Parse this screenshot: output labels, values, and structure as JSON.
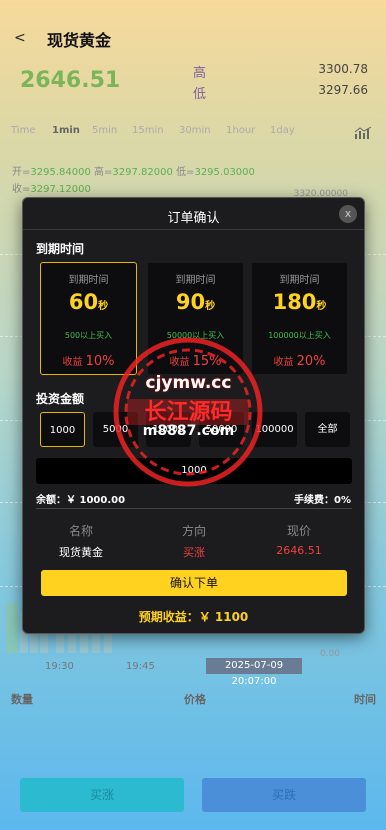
{
  "header": {
    "back": "<",
    "title": "现货黄金"
  },
  "quote": {
    "price": "2646.51",
    "high_label": "高",
    "low_label": "低",
    "high": "3300.78",
    "low": "3297.66"
  },
  "tabs": [
    {
      "label": "Time",
      "active": false
    },
    {
      "label": "1min",
      "active": true
    },
    {
      "label": "5min",
      "active": false
    },
    {
      "label": "15min",
      "active": false
    },
    {
      "label": "30min",
      "active": false
    },
    {
      "label": "1hour",
      "active": false
    },
    {
      "label": "1day",
      "active": false
    }
  ],
  "ohlc": {
    "open_label": "开=",
    "open": "3295.84000",
    "high_label": "高=",
    "high": "3297.82000",
    "low_label": "低=",
    "low": "3295.03000",
    "close_label": "收=",
    "close": "3297.12000"
  },
  "chart_axis": {
    "top_value": "3320.00000",
    "bottom_value": "0.00",
    "times": [
      "19:30",
      "19:45"
    ],
    "current_time": "2025-07-09 20:07:00"
  },
  "list_headers": {
    "qty": "数量",
    "price": "价格",
    "time": "时间"
  },
  "bottom_buttons": {
    "buy": "买涨",
    "sell": "买跌"
  },
  "modal": {
    "title": "订单确认",
    "close": "x",
    "expire_label": "到期时间",
    "expire_options": [
      {
        "label": "到期时间",
        "value": "60",
        "unit": "秒",
        "min": "500以上买入",
        "profit_label": "收益",
        "profit": "10%",
        "selected": true
      },
      {
        "label": "到期时间",
        "value": "90",
        "unit": "秒",
        "min": "50000以上买入",
        "profit_label": "收益",
        "profit": "15%",
        "selected": false
      },
      {
        "label": "到期时间",
        "value": "180",
        "unit": "秒",
        "min": "100000以上买入",
        "profit_label": "收益",
        "profit": "20%",
        "selected": false
      }
    ],
    "amount_label": "投资金额",
    "amount_options": [
      "1000",
      "5000",
      "10000",
      "50000",
      "100000",
      "全部"
    ],
    "amount_value": "1000",
    "balance": "余额：￥ 1000.00",
    "fee": "手续费：0%",
    "info": [
      {
        "head": "名称",
        "value": "现货黄金",
        "color": "#ffffff"
      },
      {
        "head": "方向",
        "value": "买涨",
        "color": "#f04040"
      },
      {
        "head": "现价",
        "value": "2646.51",
        "color": "#f04040"
      }
    ],
    "confirm": "确认下单",
    "expected": "预期收益：￥ 1100"
  },
  "watermark": {
    "line1": "cjymw.cc",
    "line2": "长江源码",
    "line3": "m8887.com"
  }
}
